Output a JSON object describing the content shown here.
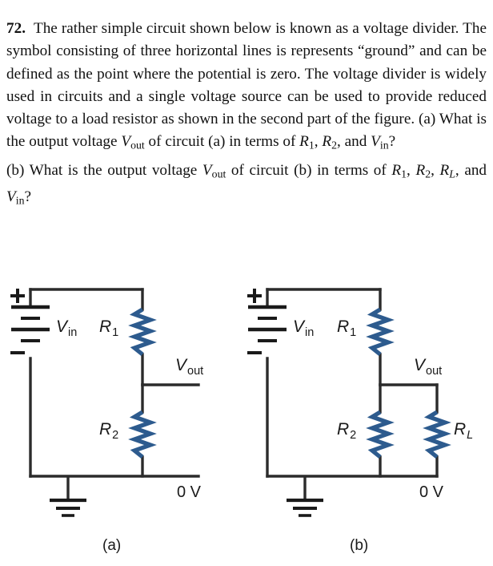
{
  "problem": {
    "number": "72.",
    "paragraph1_parts": [
      "The rather simple circuit shown below is known as a voltage divider. The symbol consisting of three horizontal lines is represents “ground” and can be defined as the point where the potential is zero. The voltage divider is widely used in circuits and a single voltage source can be used to provide reduced voltage to a load resistor as shown in the second part of the figure. (a) What is the output voltage ",
      " of circuit (a) in terms of ",
      ", ",
      ", and ",
      "?"
    ],
    "paragraph2_parts": [
      "(b) What is the output voltage ",
      " of circuit (b) in terms of ",
      ", ",
      ", ",
      ", and ",
      "?"
    ],
    "symbols": {
      "V": "V",
      "R": "R",
      "sub_out": "out",
      "sub_in": "in",
      "sub_1": "1",
      "sub_2": "2",
      "sub_L": "L"
    }
  },
  "figure": {
    "wire_color": "#2b2b2b",
    "resistor_color": "#2d5b8e",
    "circuits": [
      {
        "id": "a",
        "caption": "(a)",
        "source_label_base": "V",
        "source_label_sub": "in",
        "plus_sign": "+",
        "minus_sign": "−",
        "output_label_base": "V",
        "output_label_sub": "out",
        "ground_label": "0 V",
        "resistors": [
          {
            "name": "R1",
            "base": "R",
            "sub": "1"
          },
          {
            "name": "R2",
            "base": "R",
            "sub": "2"
          }
        ]
      },
      {
        "id": "b",
        "caption": "(b)",
        "source_label_base": "V",
        "source_label_sub": "in",
        "plus_sign": "+",
        "minus_sign": "−",
        "output_label_base": "V",
        "output_label_sub": "out",
        "ground_label": "0 V",
        "resistors": [
          {
            "name": "R1",
            "base": "R",
            "sub": "1"
          },
          {
            "name": "R2",
            "base": "R",
            "sub": "2"
          },
          {
            "name": "RL",
            "base": "R",
            "sub": "L"
          }
        ]
      }
    ]
  }
}
